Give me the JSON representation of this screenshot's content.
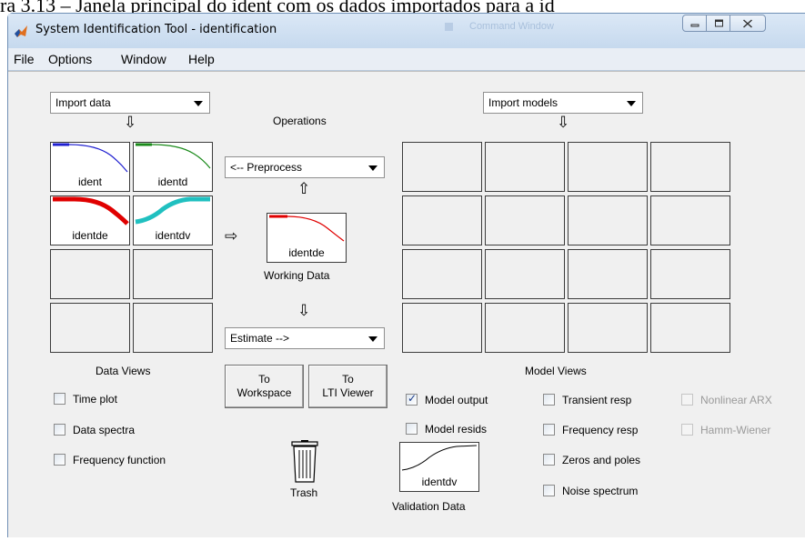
{
  "caption": "ra 3.13 – Janela principal do ident com os dados importados para a id",
  "window": {
    "title": "System Identification Tool - identification",
    "ghost_title": "Command Window",
    "controls": [
      "minimize-icon",
      "maximize-icon",
      "close-icon"
    ]
  },
  "menu": [
    "File",
    "Options",
    "Window",
    "Help"
  ],
  "data_panel": {
    "import_label": "Import data",
    "cells": [
      "ident",
      "identd",
      "identde",
      "identdv",
      "",
      "",
      "",
      ""
    ],
    "views_title": "Data Views",
    "views": [
      {
        "label": "Time plot",
        "checked": false
      },
      {
        "label": "Data spectra",
        "checked": false
      },
      {
        "label": "Frequency function",
        "checked": false
      }
    ]
  },
  "operations": {
    "title": "Operations",
    "preprocess_label": "<-- Preprocess",
    "working_data_name": "identde",
    "working_data_caption": "Working Data",
    "estimate_label": "Estimate -->",
    "to_workspace": [
      "To",
      "Workspace"
    ],
    "to_lti": [
      "To",
      "LTI Viewer"
    ],
    "trash_label": "Trash",
    "validation_name": "identdv",
    "validation_caption": "Validation Data"
  },
  "model_panel": {
    "import_label": "Import models",
    "views_title": "Model Views",
    "views": [
      {
        "label": "Model output",
        "checked": true,
        "enabled": true
      },
      {
        "label": "Model resids",
        "checked": false,
        "enabled": true
      },
      {
        "label": "Transient resp",
        "checked": false,
        "enabled": true
      },
      {
        "label": "Frequency resp",
        "checked": false,
        "enabled": true
      },
      {
        "label": "Zeros and poles",
        "checked": false,
        "enabled": true
      },
      {
        "label": "Noise spectrum",
        "checked": false,
        "enabled": true
      },
      {
        "label": "Nonlinear ARX",
        "checked": false,
        "enabled": false
      },
      {
        "label": "Hamm-Wiener",
        "checked": false,
        "enabled": false
      }
    ]
  },
  "colors": {
    "ident": "#1f1fd0",
    "identd": "#1a8a1a",
    "identde": "#e00000",
    "identdv": "#20c0c0",
    "validation": "#000000"
  }
}
